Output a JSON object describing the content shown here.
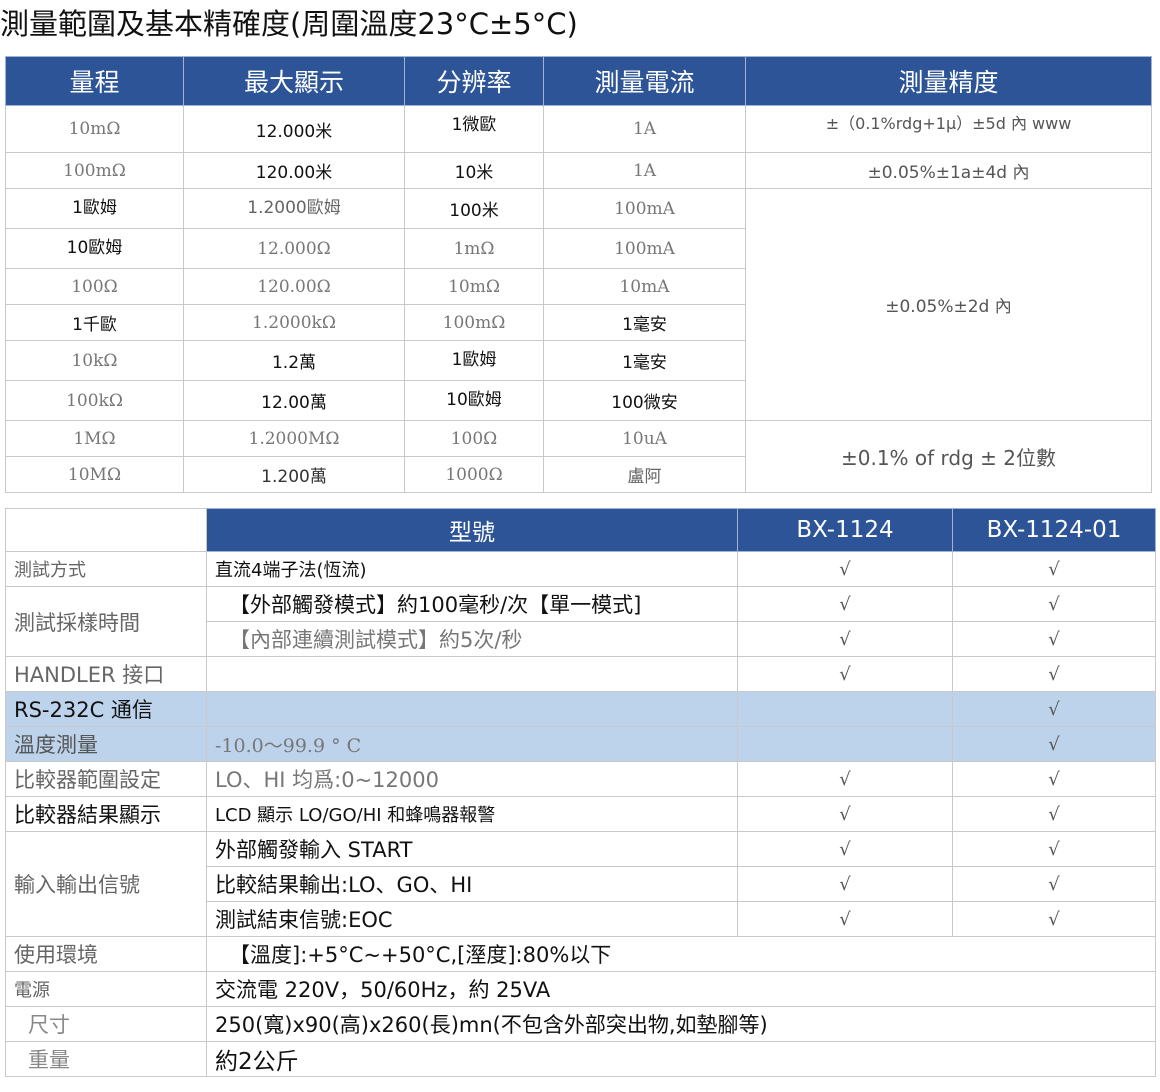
{
  "title": "測量範圍及基本精確度(周圍溫度23°C±5°C)",
  "range_table": {
    "headers": [
      "量程",
      "最大顯示",
      "分辨率",
      "測量電流",
      "測量精度"
    ],
    "rows": [
      [
        "10mΩ",
        "12.000米",
        "1微歐",
        "1A"
      ],
      [
        "100mΩ",
        "120.00米",
        "10米",
        "1A"
      ],
      [
        "1歐姆",
        "1.2000歐姆",
        "100米",
        "100mA"
      ],
      [
        "10歐姆",
        "12.000Ω",
        "1mΩ",
        "100mA"
      ],
      [
        "100Ω",
        "120.00Ω",
        "10mΩ",
        "10mA"
      ],
      [
        "1千歐",
        "1.2000kΩ",
        "100mΩ",
        "1毫安"
      ],
      [
        "10kΩ",
        "1.2萬",
        "1歐姆",
        "1毫安"
      ],
      [
        "100kΩ",
        "12.00萬",
        "10歐姆",
        "100微安"
      ],
      [
        "1MΩ",
        "1.2000MΩ",
        "100Ω",
        "10uA"
      ],
      [
        "10MΩ",
        "1.200萬",
        "1000Ω",
        "盧阿"
      ]
    ],
    "accuracy": [
      "±（0.1%rdg+1μ）±5d 內 www",
      "±0.05%±1a±4d 內",
      "±0.05%±2d 內",
      "±0.1% of rdg ± 2位數"
    ]
  },
  "spec_table": {
    "header_model": "型號",
    "models": [
      "BX-1124",
      "BX-1124-01"
    ],
    "check": "√",
    "rows": [
      {
        "label": "測試方式",
        "desc": "直流4端子法(恆流)"
      },
      {
        "label": "測試採樣時間",
        "desc": "【外部觸發模式】約100毫秒/次【單一模式]"
      },
      {
        "desc": "【內部連續測試模式】約5次/秒"
      },
      {
        "label": "HANDLER 接口",
        "desc": ""
      },
      {
        "label": "RS-232C 通信",
        "desc": ""
      },
      {
        "label": "溫度測量",
        "desc": "-10.0～99.9 ° C"
      },
      {
        "label": "比較器範圍設定",
        "desc": "LO、HI 均爲:0~12000"
      },
      {
        "label": "比較器結果顯示",
        "desc": "LCD 顯示 LO/GO/HI 和蜂鳴器報警"
      },
      {
        "label": "輸入輸出信號",
        "desc": "外部觸發輸入 START"
      },
      {
        "desc": "比較結果輸出:LO、GO、HI"
      },
      {
        "desc": "測試結束信號:EOC"
      },
      {
        "label": "使用環境",
        "desc": "【溫度]:+5°C~+50°C,[溼度]:80%以下"
      },
      {
        "label": "電源",
        "desc": "交流電 220V，50/60Hz，約 25VA"
      },
      {
        "label": "尺寸",
        "desc": "250(寬)x90(高)x260(長)mn(不包含外部突出物,如墊腳等)"
      },
      {
        "label": "重量",
        "desc": "約2公斤"
      }
    ]
  }
}
